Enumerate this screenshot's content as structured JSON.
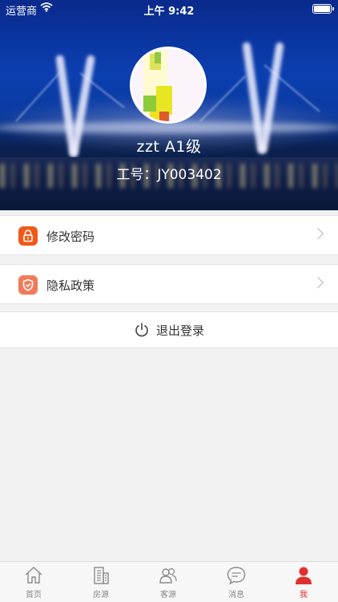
{
  "status_bar": {
    "carrier": "运营商",
    "time": "上午 9:42",
    "wifi_icon": "wifi-icon",
    "battery_icon": "battery-icon"
  },
  "profile": {
    "username": "zzt  A1级",
    "staff_id": "工号：JY003402"
  },
  "menu": {
    "change_password": {
      "label": "修改密码",
      "icon": "lock-icon",
      "color": "#f05a18"
    },
    "privacy_policy": {
      "label": "隐私政策",
      "icon": "shield-icon",
      "color": "#f07a5a"
    }
  },
  "logout": {
    "label": "退出登录",
    "icon": "power-icon"
  },
  "tabbar": {
    "items": [
      {
        "label": "首页",
        "icon": "home-icon",
        "active": false
      },
      {
        "label": "房源",
        "icon": "building-icon",
        "active": false
      },
      {
        "label": "客源",
        "icon": "users-icon",
        "active": false
      },
      {
        "label": "消息",
        "icon": "message-icon",
        "active": false
      },
      {
        "label": "我",
        "icon": "person-icon",
        "active": true
      }
    ],
    "active_color": "#e02f2f",
    "inactive_color": "#888888"
  }
}
